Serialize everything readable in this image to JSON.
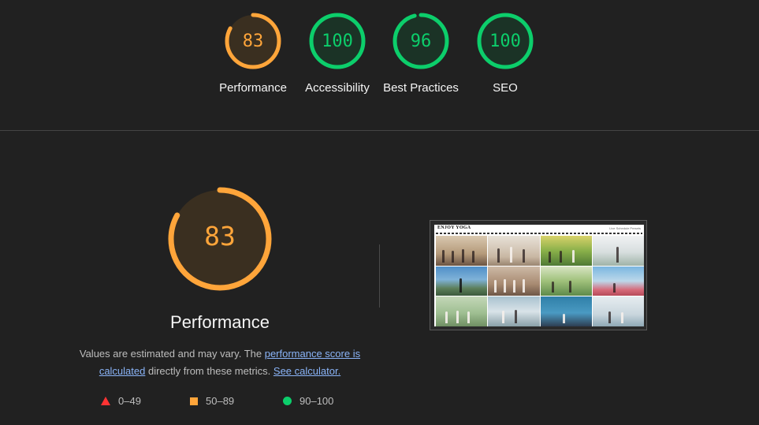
{
  "categories": [
    {
      "label": "Performance",
      "score": "83",
      "value": 83,
      "color": "#ffa53a",
      "bg": "#3a2f20"
    },
    {
      "label": "Accessibility",
      "score": "100",
      "value": 100,
      "color": "#0cce6b",
      "bg": "#1b3326"
    },
    {
      "label": "Best Practices",
      "score": "96",
      "value": 96,
      "color": "#0cce6b",
      "bg": "#1b3326"
    },
    {
      "label": "SEO",
      "score": "100",
      "value": 100,
      "color": "#0cce6b",
      "bg": "#1b3326"
    }
  ],
  "performance": {
    "score": "83",
    "value": 83,
    "title": "Performance",
    "color": "#ffa53a",
    "desc_prefix": "Values are estimated and may vary. The ",
    "link_score": "performance score is calculated",
    "desc_middle": " directly from these metrics. ",
    "link_calculator": "See calculator."
  },
  "legend": [
    {
      "icon": "triangle-icon",
      "label": "0–49",
      "color": "#ff3333"
    },
    {
      "icon": "square-icon",
      "label": "50–89",
      "color": "#ffa53a"
    },
    {
      "icon": "circle-icon",
      "label": "90–100",
      "color": "#0cce6b"
    }
  ],
  "thumbnail": {
    "site_title": "ENJOY YOGA",
    "nav": "Live  Schedule  Presets"
  }
}
